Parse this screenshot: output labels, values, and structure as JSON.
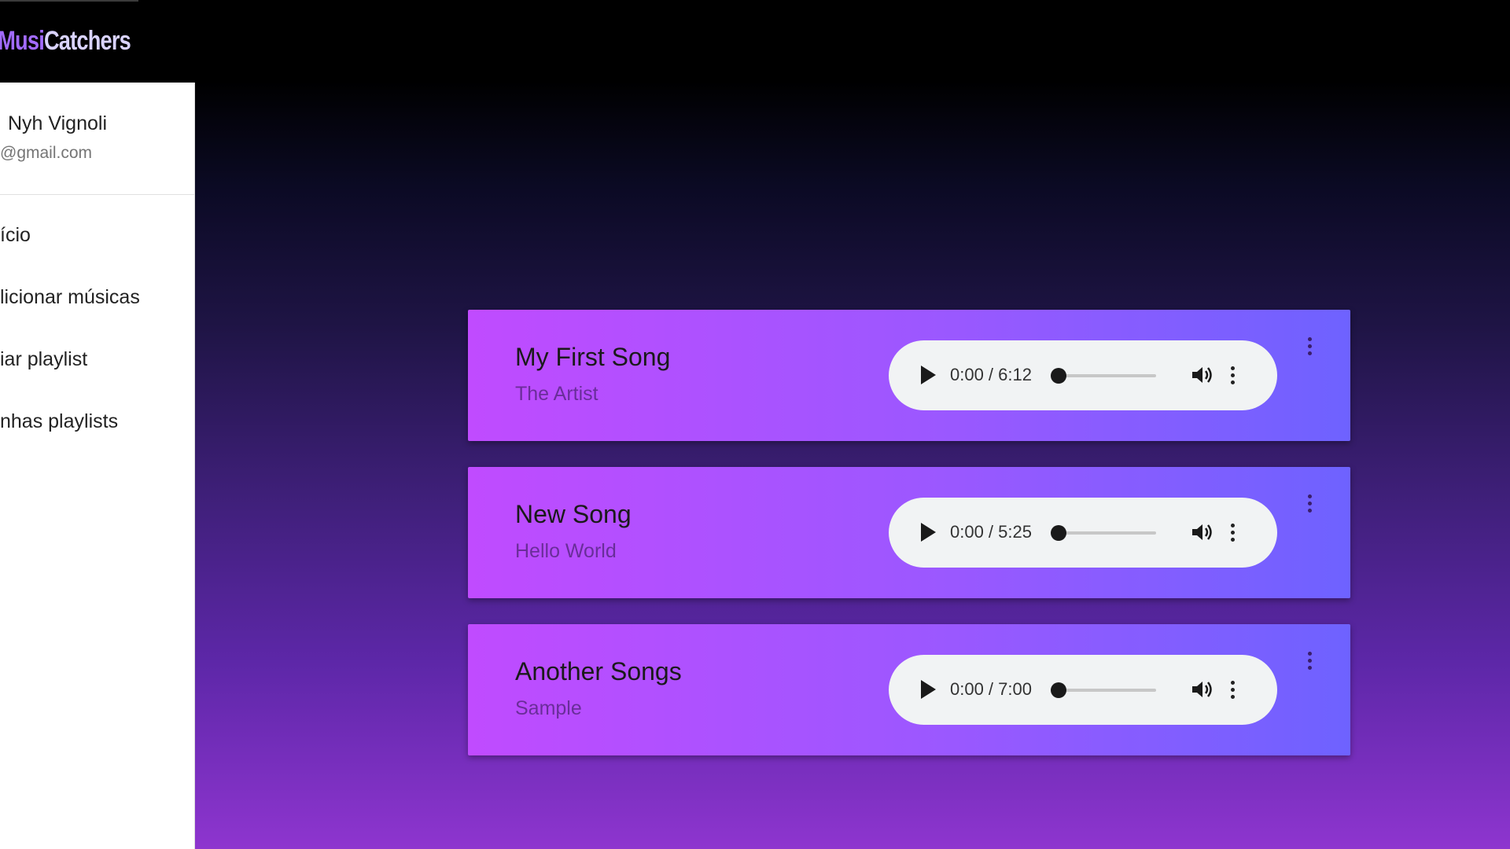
{
  "app": {
    "logo_mark": "",
    "logo_part1": "Musi",
    "logo_part2": "Catchers"
  },
  "user": {
    "name": "Nyh Vignoli",
    "email": "@gmail.com"
  },
  "nav": {
    "items": [
      {
        "label": "ício"
      },
      {
        "label": "licionar músicas"
      },
      {
        "label": "iar playlist"
      },
      {
        "label": "nhas playlists"
      }
    ]
  },
  "songs": [
    {
      "title": "My First Song",
      "artist": "The Artist",
      "time": "0:00 / 6:12",
      "progress": 0
    },
    {
      "title": "New Song",
      "artist": "Hello World",
      "time": "0:00 / 5:25",
      "progress": 0
    },
    {
      "title": "Another Songs",
      "artist": "Sample",
      "time": "0:00 / 7:00",
      "progress": 0
    }
  ],
  "icons": {
    "play": "play-icon",
    "volume": "volume-icon",
    "more": "more-vertical-icon"
  },
  "colors": {
    "card_start": "#c04bff",
    "card_end": "#6e62ff",
    "logo_accent": "#a26bff"
  }
}
